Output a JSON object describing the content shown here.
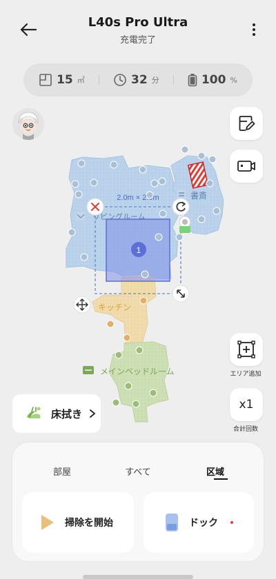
{
  "header": {
    "title": "L40s Pro Ultra",
    "subtitle": "充電完了"
  },
  "stats": {
    "area_value": "15",
    "area_unit": "㎡",
    "time_value": "32",
    "time_unit": "分",
    "battery_value": "100",
    "battery_unit": "%"
  },
  "map": {
    "zone_size_label": "2.0m × 2.0m",
    "zone_number": "1",
    "rooms": {
      "study": "書斎",
      "living": "リビングルーム",
      "kitchen": "キッチン",
      "bedroom": "メインベッドルーム"
    }
  },
  "side_buttons": {
    "add_area_caption": "エリア追加",
    "count_label": "x1",
    "count_caption": "合計回数"
  },
  "mop": {
    "label": "床拭き"
  },
  "tabs": [
    {
      "label": "部屋"
    },
    {
      "label": "すべて"
    },
    {
      "label": "区域"
    }
  ],
  "actions": {
    "start_label": "掃除を開始",
    "dock_label": "ドック"
  },
  "colors": {
    "living_room": "#bcd3ec",
    "kitchen": "#f2dcae",
    "bedroom": "#cfe0b6",
    "zone": "#7f8fe8",
    "dock_dot": "#e53935",
    "start_icon": "#e9bf7c"
  }
}
